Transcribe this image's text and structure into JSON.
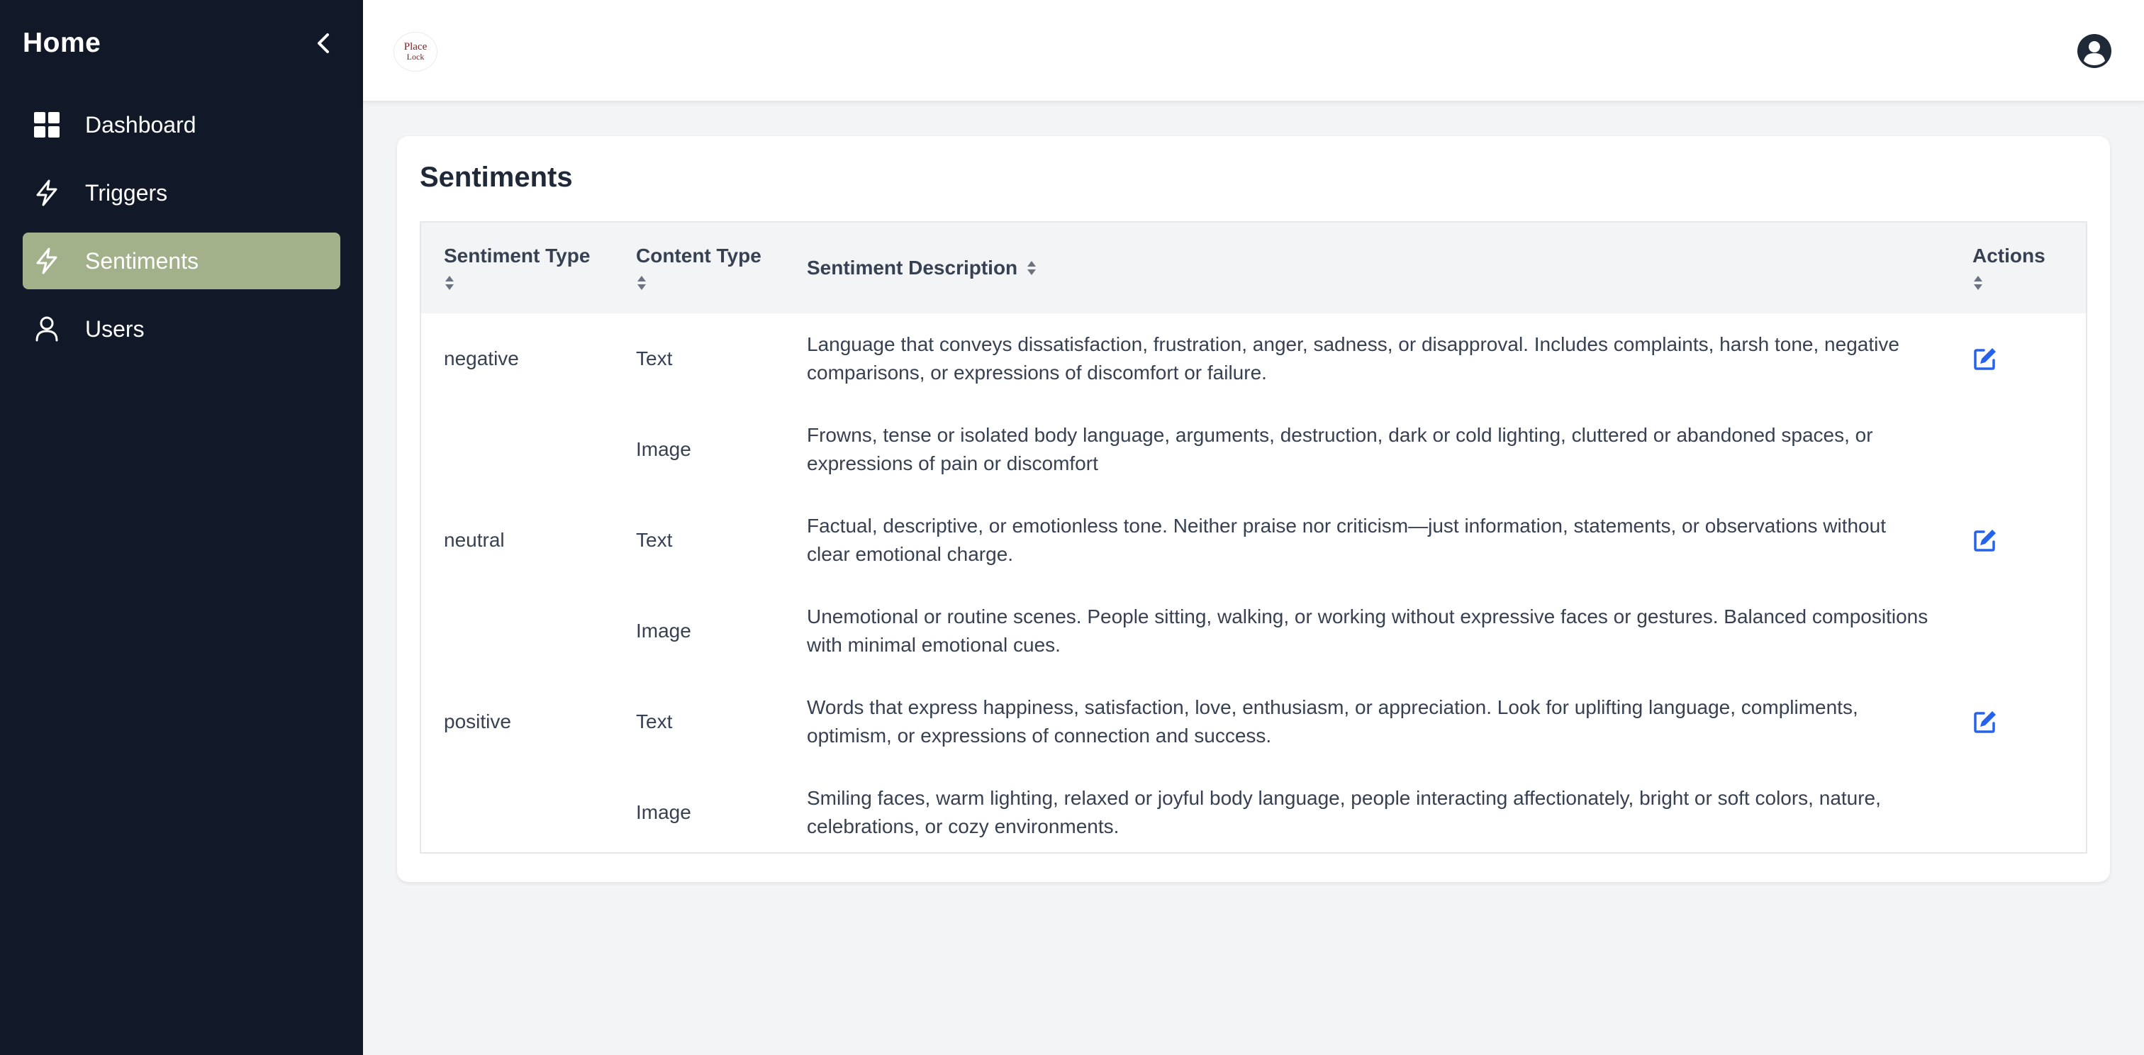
{
  "sidebar": {
    "title": "Home",
    "items": [
      {
        "label": "Dashboard",
        "icon": "grid-icon",
        "active": false
      },
      {
        "label": "Triggers",
        "icon": "bolt-icon",
        "active": false
      },
      {
        "label": "Sentiments",
        "icon": "bolt-icon",
        "active": true
      },
      {
        "label": "Users",
        "icon": "user-icon",
        "active": false
      }
    ]
  },
  "topbar": {
    "logo_line1": "Place",
    "logo_line2": "Lock"
  },
  "page": {
    "title": "Sentiments"
  },
  "table": {
    "headers": {
      "sentiment_type": "Sentiment Type",
      "content_type": "Content Type",
      "description": "Sentiment Description",
      "actions": "Actions"
    },
    "rows": [
      {
        "sentiment": "negative",
        "content": "Text",
        "description": "Language that conveys dissatisfaction, frustration, anger, sadness, or disapproval. Includes complaints, harsh tone, negative comparisons, or expressions of discomfort or failure."
      },
      {
        "sentiment": "",
        "content": "Image",
        "description": "Frowns, tense or isolated body language, arguments, destruction, dark or cold lighting, cluttered or abandoned spaces, or expressions of pain or discomfort"
      },
      {
        "sentiment": "neutral",
        "content": "Text",
        "description": "Factual, descriptive, or emotionless tone. Neither praise nor criticism—just information, statements, or observations without clear emotional charge."
      },
      {
        "sentiment": "",
        "content": "Image",
        "description": "Unemotional or routine scenes. People sitting, walking, or working without expressive faces or gestures. Balanced compositions with minimal emotional cues."
      },
      {
        "sentiment": "positive",
        "content": "Text",
        "description": "Words that express happiness, satisfaction, love, enthusiasm, or appreciation. Look for uplifting language, compliments, optimism, or expressions of connection and success."
      },
      {
        "sentiment": "",
        "content": "Image",
        "description": "Smiling faces, warm lighting, relaxed or joyful body language, people interacting affectionately, bright or soft colors, nature, celebrations, or cozy environments."
      }
    ]
  },
  "colors": {
    "sidebar_bg": "#111827",
    "active_item": "#a3b18a",
    "accent_blue": "#2563eb",
    "page_bg": "#f3f4f6"
  }
}
